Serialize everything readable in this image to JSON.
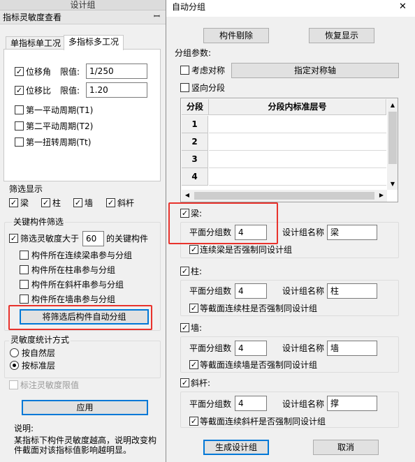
{
  "left": {
    "top_bar": "设计组",
    "title": "指标灵敏度查看",
    "pin": "ꟷ",
    "tabs": [
      "单指标单工况",
      "多指标多工况"
    ],
    "criteria": [
      {
        "label": "位移角",
        "checked": true,
        "limit_label": "限值:",
        "limit_value": "1/250"
      },
      {
        "label": "位移比",
        "checked": true,
        "limit_label": "限值:",
        "limit_value": "1.20"
      }
    ],
    "periods": [
      {
        "label": "第一平动周期(T1)",
        "checked": false
      },
      {
        "label": "第二平动周期(T2)",
        "checked": false
      },
      {
        "label": "第一扭转周期(Tt)",
        "checked": false
      }
    ],
    "filter_display": {
      "legend": "筛选显示",
      "items": [
        {
          "label": "梁",
          "checked": true
        },
        {
          "label": "柱",
          "checked": true
        },
        {
          "label": "墙",
          "checked": true
        },
        {
          "label": "斜杆",
          "checked": true
        }
      ]
    },
    "key_filter": {
      "legend": "关键构件筛选",
      "prefix": "筛选灵敏度大于",
      "value": "60",
      "suffix": "的关键构件",
      "checked": true,
      "options": [
        "构件所在连续梁串参与分组",
        "构件所在柱串参与分组",
        "构件所在斜杆串参与分组",
        "构件所在墙串参与分组"
      ],
      "auto_group_button": "将筛选后构件自动分组"
    },
    "stat_method": {
      "legend": "灵敏度统计方式",
      "options": [
        "按自然层",
        "按标准层"
      ],
      "selected": 1
    },
    "mark_limit": "标注灵敏度限值",
    "apply_button": "应用",
    "note_title": "说明:",
    "note_text": "某指标下构件灵敏度越高，说明改变构件截面对该指标值影响越明显。"
  },
  "dialog": {
    "title": "自动分组",
    "close": "✕",
    "remove_button": "构件剔除",
    "restore_button": "恢复显示",
    "params_label": "分组参数:",
    "symmetry_label": "考虑对称",
    "symmetry_axis_button": "指定对称轴",
    "vertical_label": "竖向分段",
    "grid": {
      "col_segment": "分段",
      "col_floors": "分段内标准层号",
      "rows": [
        "1",
        "2",
        "3",
        "4"
      ]
    },
    "sections": [
      {
        "label": "梁:",
        "checked": true,
        "count_label": "平面分组数",
        "count": "4",
        "name_label": "设计组名称",
        "name": "梁",
        "force_label": "连续梁是否强制同设计组",
        "force": true
      },
      {
        "label": "柱:",
        "checked": true,
        "count_label": "平面分组数",
        "count": "4",
        "name_label": "设计组名称",
        "name": "柱",
        "force_label": "等截面连续柱是否强制同设计组",
        "force": true
      },
      {
        "label": "墙:",
        "checked": true,
        "count_label": "平面分组数",
        "count": "4",
        "name_label": "设计组名称",
        "name": "墙",
        "force_label": "等截面连续墙是否强制同设计组",
        "force": true
      },
      {
        "label": "斜杆:",
        "checked": true,
        "count_label": "平面分组数",
        "count": "4",
        "name_label": "设计组名称",
        "name": "撑",
        "force_label": "等截面连续斜杆是否强制同设计组",
        "force": true
      }
    ],
    "generate_button": "生成设计组",
    "cancel_button": "取消"
  },
  "colors": {
    "highlight": "#e8322c",
    "focus": "#0078d7"
  }
}
